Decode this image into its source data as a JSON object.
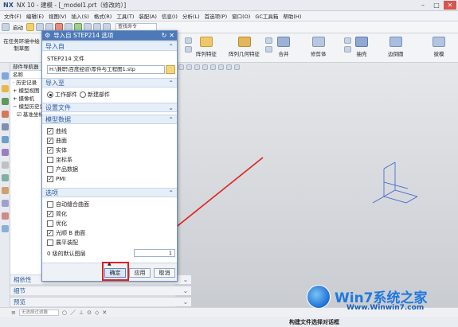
{
  "titlebar": {
    "app": "NX",
    "title": "NX 10 - 建模 - [_model1.prt（修改的）]"
  },
  "menubar": {
    "items": [
      "文件(F)",
      "编辑(E)",
      "视图(V)",
      "插入(S)",
      "格式(R)",
      "工具(T)",
      "装配(A)",
      "信息(I)",
      "分析(L)",
      "首选项(P)",
      "窗口(O)",
      "GC工具箱",
      "帮助(H)"
    ]
  },
  "toolbar": {
    "start_label": "启动",
    "search_placeholder": "查找命令"
  },
  "ribbon": {
    "left_label": "在任务环境中绘制草图",
    "items": [
      "阵列特征",
      "阵列几何特征",
      "合并",
      "修剪体",
      "抽壳",
      "边倒圆",
      "拔模"
    ]
  },
  "navigator": {
    "header": "部件导航器",
    "column": "名称",
    "rows": [
      "历史记录",
      "模型视图",
      "摄像机",
      "模型历史记录",
      "基准坐标系"
    ]
  },
  "bottom_panels": [
    "相依性",
    "细节",
    "预览"
  ],
  "statusbar": {
    "filter_placeholder": "无选择过滤器",
    "message": "构建文件选择对话框"
  },
  "dialog": {
    "title": "导入自 STEP214 选项",
    "sections": {
      "import_from": "导入自",
      "import_to": "导入至",
      "settings_file": "设置文件",
      "model_data": "模型数据",
      "options": "选项"
    },
    "file_label": "STEP214 文件",
    "file_path": "H:\\兼职\\百度经验\\零件与工程图1.stp",
    "import_to_options": [
      {
        "label": "工作部件",
        "selected": true
      },
      {
        "label": "新建部件",
        "selected": false
      }
    ],
    "model_data": [
      {
        "label": "曲线",
        "checked": true
      },
      {
        "label": "曲面",
        "checked": true
      },
      {
        "label": "实体",
        "checked": true
      },
      {
        "label": "坐标系",
        "checked": false
      },
      {
        "label": "产品数据",
        "checked": false
      },
      {
        "label": "PMI",
        "checked": true
      }
    ],
    "options": [
      {
        "label": "自动缝合曲面",
        "checked": false
      },
      {
        "label": "简化",
        "checked": true
      },
      {
        "label": "优化",
        "checked": false
      },
      {
        "label": "光顺 B 曲面",
        "checked": true
      },
      {
        "label": "展平装配",
        "checked": false
      }
    ],
    "layer_label": "0 级的默认图层",
    "layer_value": "1",
    "buttons": {
      "ok": "确定",
      "apply": "应用",
      "cancel": "取消"
    }
  },
  "watermark": {
    "title": "Win7系统之家",
    "url": "Www.Winwin7.com"
  },
  "colors": {
    "dialog_title": "#4e79b8",
    "section_text": "#2c5aa0",
    "highlight_red": "#e02020",
    "axis_blue": "#3b5fd0"
  }
}
